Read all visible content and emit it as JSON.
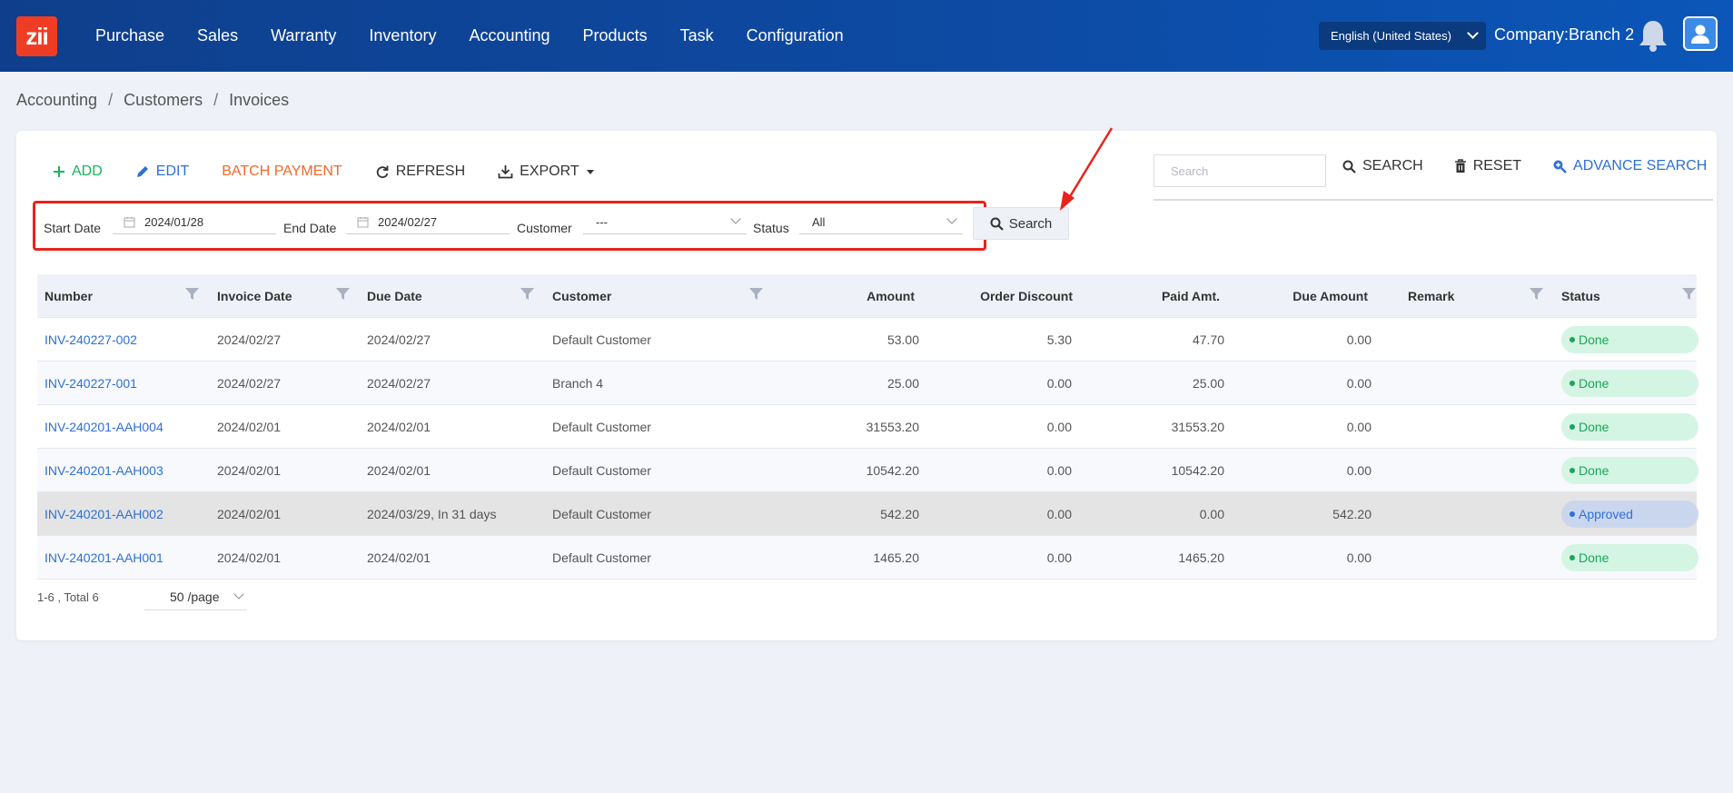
{
  "app": {
    "logo_text": "zii",
    "brand_color": "#ee3d24"
  },
  "nav": {
    "items": [
      "Purchase",
      "Sales",
      "Warranty",
      "Inventory",
      "Accounting",
      "Products",
      "Task",
      "Configuration"
    ]
  },
  "header": {
    "language": "English (United States)",
    "company": "Company:Branch 2"
  },
  "breadcrumb": [
    "Accounting",
    "Customers",
    "Invoices"
  ],
  "toolbar": {
    "add": "ADD",
    "edit": "EDIT",
    "batch_payment": "BATCH PAYMENT",
    "refresh": "REFRESH",
    "export": "EXPORT",
    "search_placeholder": "Search",
    "search": "SEARCH",
    "reset": "RESET",
    "advance_search": "ADVANCE SEARCH"
  },
  "filters": {
    "start_date_label": "Start Date",
    "start_date": "2024/01/28",
    "end_date_label": "End Date",
    "end_date": "2024/02/27",
    "customer_label": "Customer",
    "customer": "---",
    "status_label": "Status",
    "status": "All",
    "search_button": "Search"
  },
  "table": {
    "columns": [
      "Number",
      "Invoice Date",
      "Due Date",
      "Customer",
      "Amount",
      "Order Discount",
      "Paid Amt.",
      "Due Amount",
      "Remark",
      "Status"
    ],
    "rows": [
      {
        "number": "INV-240227-002",
        "invoice_date": "2024/02/27",
        "due_date": "2024/02/27",
        "customer": "Default Customer",
        "amount": "53.00",
        "order_discount": "5.30",
        "paid": "47.70",
        "due_amount": "0.00",
        "remark": "",
        "status": "Done"
      },
      {
        "number": "INV-240227-001",
        "invoice_date": "2024/02/27",
        "due_date": "2024/02/27",
        "customer": "Branch 4",
        "amount": "25.00",
        "order_discount": "0.00",
        "paid": "25.00",
        "due_amount": "0.00",
        "remark": "",
        "status": "Done"
      },
      {
        "number": "INV-240201-AAH004",
        "invoice_date": "2024/02/01",
        "due_date": "2024/02/01",
        "customer": "Default Customer",
        "amount": "31553.20",
        "order_discount": "0.00",
        "paid": "31553.20",
        "due_amount": "0.00",
        "remark": "",
        "status": "Done"
      },
      {
        "number": "INV-240201-AAH003",
        "invoice_date": "2024/02/01",
        "due_date": "2024/02/01",
        "customer": "Default Customer",
        "amount": "10542.20",
        "order_discount": "0.00",
        "paid": "10542.20",
        "due_amount": "0.00",
        "remark": "",
        "status": "Done"
      },
      {
        "number": "INV-240201-AAH002",
        "invoice_date": "2024/02/01",
        "due_date": "2024/03/29, In 31 days",
        "customer": "Default Customer",
        "amount": "542.20",
        "order_discount": "0.00",
        "paid": "0.00",
        "due_amount": "542.20",
        "remark": "",
        "status": "Approved"
      },
      {
        "number": "INV-240201-AAH001",
        "invoice_date": "2024/02/01",
        "due_date": "2024/02/01",
        "customer": "Default Customer",
        "amount": "1465.20",
        "order_discount": "0.00",
        "paid": "1465.20",
        "due_amount": "0.00",
        "remark": "",
        "status": "Done"
      }
    ]
  },
  "pager": {
    "summary": "1-6 , Total 6",
    "page_size": "50 /page"
  },
  "colors": {
    "done": "#1aa55a",
    "approved": "#2e6fd6",
    "link": "#2e6fd6",
    "add": "#18b35f",
    "batch": "#f06a2b"
  }
}
